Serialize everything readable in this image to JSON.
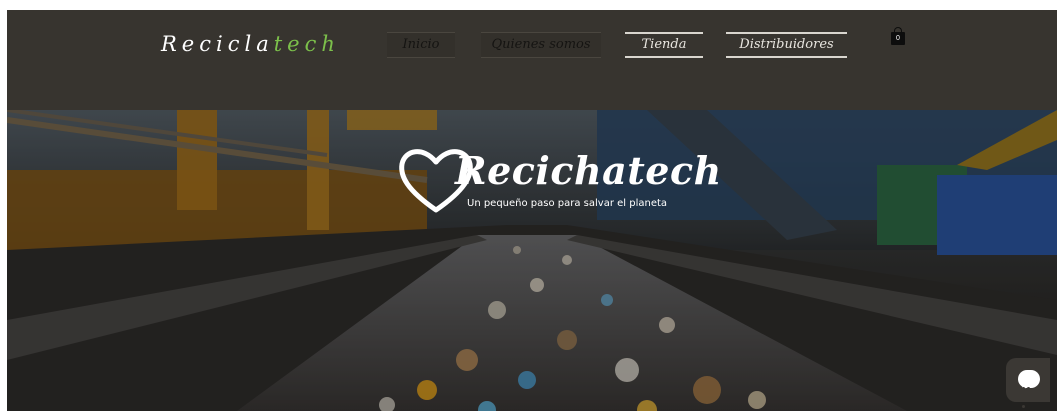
{
  "header": {
    "logo_part1": "Recicla",
    "logo_part2": "tech",
    "nav": [
      {
        "label": "Inicio"
      },
      {
        "label": "Quienes somos"
      },
      {
        "label": "Tienda"
      },
      {
        "label": "Distribuidores"
      }
    ],
    "cart_count": "0"
  },
  "hero": {
    "brand_title": "Recichatech",
    "brand_tagline": "Un pequeño paso para salvar el planeta"
  },
  "colors": {
    "background": "#37342f",
    "logo_accent": "#7cc04b",
    "nav_text_light": "#e8e5df"
  },
  "icons": {
    "cart": "shopping-bag-icon",
    "chat": "chat-bubble-icon",
    "brand": "heart-icon"
  }
}
